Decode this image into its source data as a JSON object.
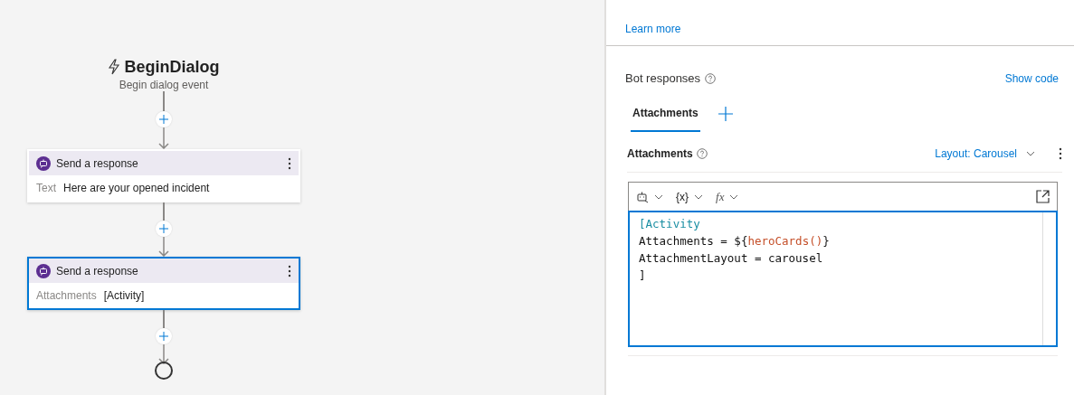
{
  "canvas": {
    "trigger": {
      "title": "BeginDialog",
      "subtitle": "Begin dialog event"
    },
    "nodes": [
      {
        "title": "Send a response",
        "label": "Text",
        "value": "Here are your opened incident",
        "selected": false
      },
      {
        "title": "Send a response",
        "label": "Attachments",
        "value": "[Activity]",
        "selected": true
      }
    ]
  },
  "panel": {
    "learn_more": "Learn more",
    "bot_responses": {
      "title": "Bot responses",
      "show_code": "Show code"
    },
    "tabs": [
      {
        "label": "Attachments",
        "selected": true
      }
    ],
    "section": {
      "title": "Attachments",
      "layout": "Layout: Carousel"
    },
    "editor": {
      "toolbar": [
        {
          "kind": "icon"
        },
        {
          "kind": "text",
          "label": "{x}"
        },
        {
          "kind": "text",
          "label": "fx"
        }
      ],
      "lines": [
        [
          {
            "text": "[Activity",
            "kind": "keyword"
          }
        ],
        [
          {
            "text": "Attachments = ${",
            "kind": "plain"
          },
          {
            "text": "heroCards()",
            "kind": "function"
          },
          {
            "text": "}",
            "kind": "plain"
          }
        ],
        [
          {
            "text": "AttachmentLayout = carousel",
            "kind": "plain"
          }
        ],
        [
          {
            "text": "]",
            "kind": "plain"
          }
        ]
      ]
    }
  }
}
